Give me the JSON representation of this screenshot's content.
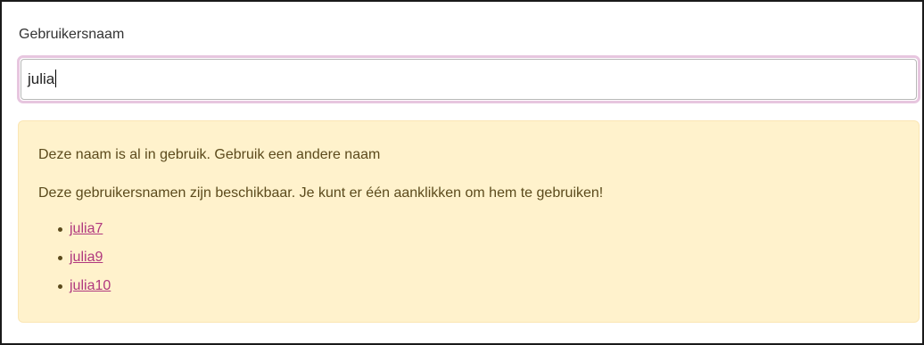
{
  "form": {
    "username_label": "Gebruikersnaam",
    "username_value": "julia"
  },
  "alert": {
    "message": "Deze naam is al in gebruik. Gebruik een andere naam",
    "hint": "Deze gebruikersnamen zijn beschikbaar. Je kunt er één aanklikken om hem te gebruiken!",
    "suggestions": [
      "julia7",
      "julia9",
      "julia10"
    ]
  },
  "colors": {
    "alert_background": "#fff2cc",
    "link": "#b0387e",
    "focus_ring": "#e7c6df"
  }
}
